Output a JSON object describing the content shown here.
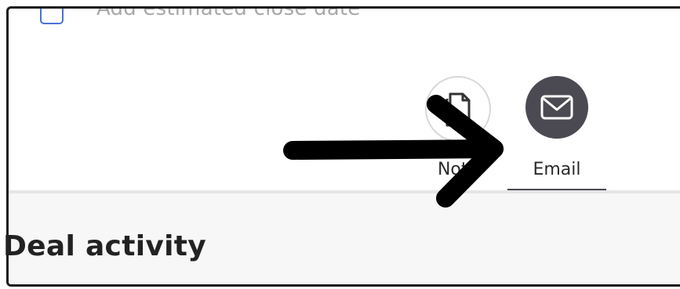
{
  "checklist": {
    "estimated_close_date_label": "Add estimated close date"
  },
  "activity_tabs": {
    "note_label": "Note",
    "email_label": "Email",
    "active": "email"
  },
  "section": {
    "title": "Deal activity"
  },
  "annotation": {
    "type": "arrow",
    "points_to": "email-tab",
    "color": "#000000"
  },
  "colors": {
    "email_active": "#4b4a52",
    "checkbox_border": "#4a72d8"
  }
}
